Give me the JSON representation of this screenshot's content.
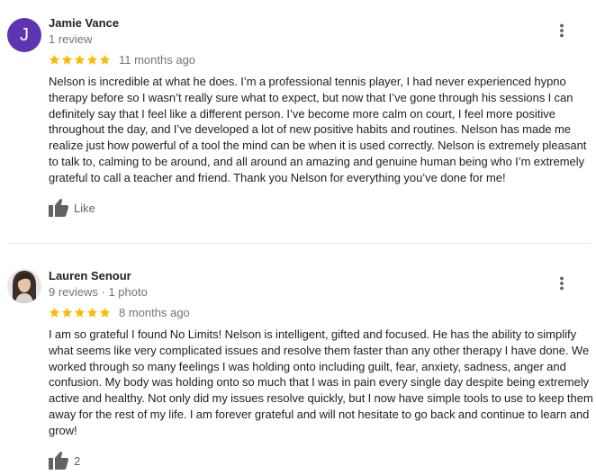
{
  "colors": {
    "star": "#fbbc04",
    "avatar_bg": "#5e35b1",
    "meta_text": "#70757a",
    "divider": "#e8eaed"
  },
  "reviews": [
    {
      "avatar_letter": "J",
      "author": "Jamie Vance",
      "meta": "1 review",
      "rating": 5,
      "date": "11 months ago",
      "text": "Nelson is incredible at what he does. I’m a professional tennis player, I had never experienced hypno therapy before so I wasn’t really sure what to expect, but now that I’ve gone through his sessions I can definitely say that I feel like a different person. I’ve become more calm on court, I feel more positive throughout the day, and I’ve developed a lot of new positive habits and routines. Nelson has made me realize just how powerful of a tool the mind can be when it is used correctly. Nelson is extremely pleasant to talk to, calming to be around, and all around an amazing and genuine human being who I’m extremely grateful to call a teacher and friend.  Thank you Nelson for everything you’ve done for me!",
      "like_label": "Like",
      "more_icon": "more-vert-icon",
      "like_icon": "thumb-up-icon"
    },
    {
      "avatar_photo": true,
      "author": "Lauren Senour",
      "meta": "9 reviews · 1 photo",
      "rating": 5,
      "date": "8 months ago",
      "text": "I am so grateful I found No Limits! Nelson is intelligent, gifted and focused. He has the ability to simplify what seems like very complicated issues and resolve them faster than any other therapy I have done. We worked through so many feelings I was holding onto including guilt, fear, anxiety, sadness, anger and confusion. My body was holding onto so much that I was in pain every single day despite being extremely active and healthy. Not only did my issues resolve quickly, but I now have simple tools to use to keep them away for the rest of my life. I am forever grateful and will not hesitate to go back and continue to learn and grow!",
      "like_label": "2",
      "more_icon": "more-vert-icon",
      "like_icon": "thumb-up-icon"
    }
  ]
}
